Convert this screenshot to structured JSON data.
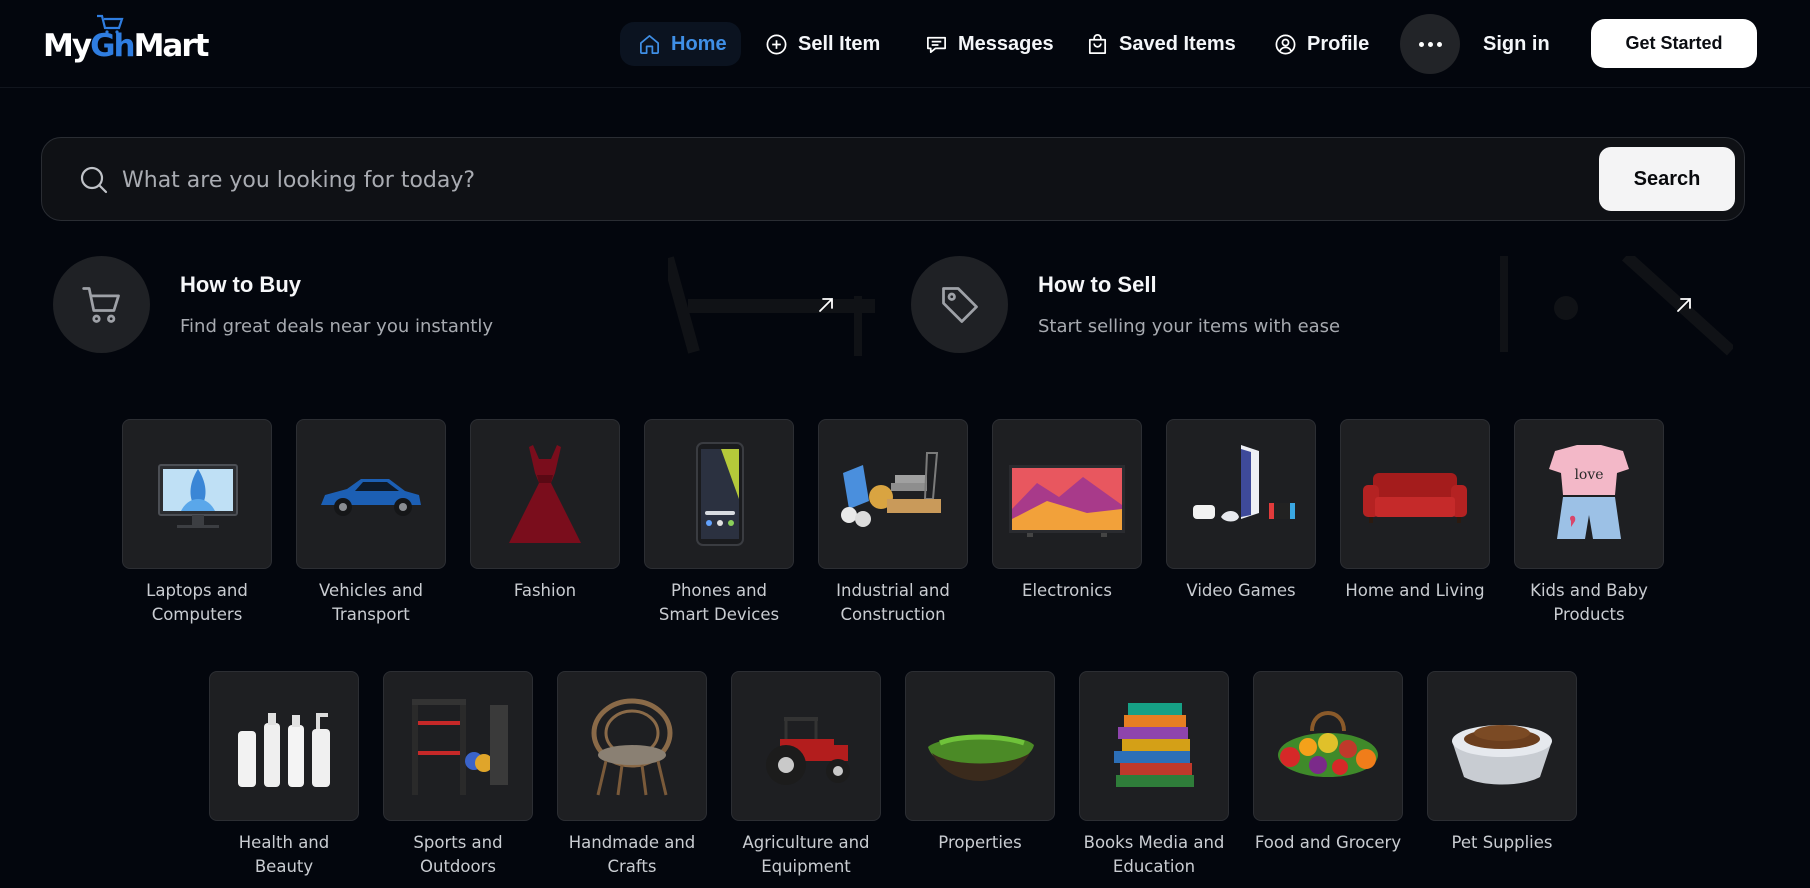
{
  "brand": {
    "logo_prefix": "My",
    "logo_middle": "Gh",
    "logo_suffix": "Mart"
  },
  "nav": {
    "home": "Home",
    "sell_item": "Sell Item",
    "messages": "Messages",
    "saved_items": "Saved Items",
    "profile": "Profile",
    "sign_in": "Sign in",
    "get_started": "Get Started",
    "active_color": "#3f8fe6"
  },
  "search": {
    "placeholder": "What are you looking for today?",
    "value": "",
    "button_label": "Search"
  },
  "how_to": {
    "buy": {
      "title": "How to Buy",
      "subtitle": "Find great deals near you instantly",
      "icon": "cart-icon"
    },
    "sell": {
      "title": "How to Sell",
      "subtitle": "Start selling your items with ease",
      "icon": "tag-icon"
    }
  },
  "categories": [
    {
      "label": "Laptops and Computers",
      "icon": "monitor"
    },
    {
      "label": "Vehicles and Transport",
      "icon": "car"
    },
    {
      "label": "Fashion",
      "icon": "dress"
    },
    {
      "label": "Phones and Smart Devices",
      "icon": "phone"
    },
    {
      "label": "Industrial and Construction",
      "icon": "construction"
    },
    {
      "label": "Electronics",
      "icon": "tv"
    },
    {
      "label": "Video Games",
      "icon": "console"
    },
    {
      "label": "Home and Living",
      "icon": "sofa"
    },
    {
      "label": "Kids and Baby Products",
      "icon": "kids-clothes"
    },
    {
      "label": "Health and Beauty",
      "icon": "bottles"
    },
    {
      "label": "Sports and Outdoors",
      "icon": "gym-rack"
    },
    {
      "label": "Handmade and Crafts",
      "icon": "rattan-chair"
    },
    {
      "label": "Agriculture and Equipment",
      "icon": "tractor"
    },
    {
      "label": "Properties",
      "icon": "land"
    },
    {
      "label": "Books Media and Education",
      "icon": "books"
    },
    {
      "label": "Food and Grocery",
      "icon": "produce"
    },
    {
      "label": "Pet Supplies",
      "icon": "pet-bowl"
    }
  ]
}
